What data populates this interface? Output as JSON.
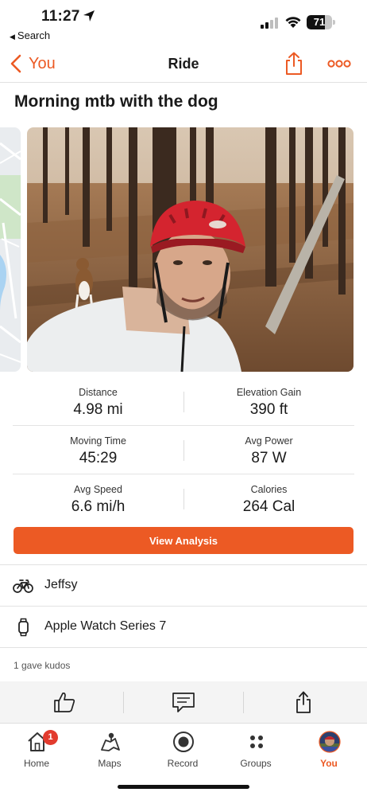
{
  "status_bar": {
    "time": "11:27",
    "back_app": "Search",
    "battery_level": "71",
    "battery_fraction": 0.71
  },
  "nav": {
    "back_label": "You",
    "title": "Ride"
  },
  "activity": {
    "title": "Morning mtb with the dog"
  },
  "stats": [
    {
      "left_label": "Distance",
      "left_value": "4.98 mi",
      "right_label": "Elevation Gain",
      "right_value": "390 ft"
    },
    {
      "left_label": "Moving Time",
      "left_value": "45:29",
      "right_label": "Avg Power",
      "right_value": "87 W"
    },
    {
      "left_label": "Avg Speed",
      "left_value": "6.6 mi/h",
      "right_label": "Calories",
      "right_value": "264 Cal"
    }
  ],
  "view_analysis_label": "View Analysis",
  "gear": {
    "bike": "Jeffsy",
    "device": "Apple Watch Series 7"
  },
  "kudos_text": "1 gave kudos",
  "tabs": [
    {
      "label": "Home",
      "icon": "home-icon",
      "badge": "1"
    },
    {
      "label": "Maps",
      "icon": "maps-icon"
    },
    {
      "label": "Record",
      "icon": "record-icon"
    },
    {
      "label": "Groups",
      "icon": "groups-icon"
    },
    {
      "label": "You",
      "icon": "avatar-icon",
      "active": true
    }
  ],
  "colors": {
    "accent": "#ec5a24",
    "badge": "#e23b2e"
  }
}
